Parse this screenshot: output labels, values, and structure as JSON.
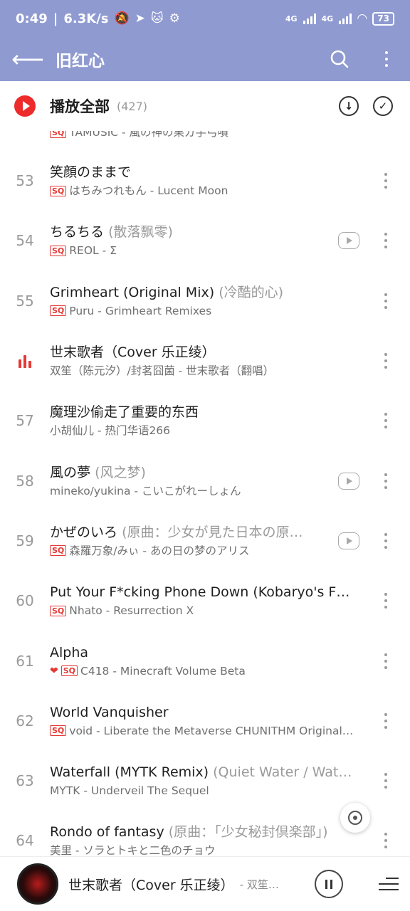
{
  "status": {
    "time": "0:49",
    "speed": "6.3K/s",
    "net1": "4G",
    "net2": "4G",
    "battery": "73"
  },
  "appbar": {
    "title": "旧红心",
    "back_icon": "arrow-left-icon",
    "search_icon": "search-icon",
    "more_icon": "more-vertical-icon"
  },
  "play_all": {
    "label": "播放全部",
    "count": "(427)"
  },
  "partial_row": {
    "subtitle": "TAMUSIC - 風の神の果ガ手弓噴"
  },
  "songs": [
    {
      "num": "53",
      "title": "笑顔のままで",
      "alias": "",
      "sq": true,
      "heart": false,
      "mv": false,
      "sub": "はちみつれもん - Lucent Moon"
    },
    {
      "num": "54",
      "title": "ちるちる",
      "alias": "(散落飘零)",
      "sq": true,
      "heart": false,
      "mv": true,
      "sub": "REOL - Σ"
    },
    {
      "num": "55",
      "title": "Grimheart (Original Mix)",
      "alias": "(冷酷的心)",
      "sq": true,
      "heart": false,
      "mv": false,
      "sub": "Puru - Grimheart Remixes"
    },
    {
      "num": "",
      "title": "世末歌者（Cover 乐正绫）",
      "alias": "",
      "sq": false,
      "heart": false,
      "mv": false,
      "playing": true,
      "sub": "双笙（陈元汐）/封茗囧菌 - 世末歌者（翻唱）"
    },
    {
      "num": "57",
      "title": "魔理沙偷走了重要的东西",
      "alias": "",
      "sq": false,
      "heart": false,
      "mv": false,
      "sub": "小胡仙儿 - 热门华语266"
    },
    {
      "num": "58",
      "title": "風の夢",
      "alias": "(风之梦)",
      "sq": false,
      "heart": false,
      "mv": true,
      "sub": "mineko/yukina - こいこがれーしょん"
    },
    {
      "num": "59",
      "title": "かぜのいろ",
      "alias": "(原曲：少女が見た日本の原…",
      "sq": true,
      "heart": false,
      "mv": true,
      "sub": "森羅万象/みぃ - あの日の梦のアリス"
    },
    {
      "num": "60",
      "title": "Put Your F*cking Phone Down (Kobaryo's F…",
      "alias": "",
      "sq": true,
      "heart": false,
      "mv": false,
      "sub": "Nhato - Resurrection X"
    },
    {
      "num": "61",
      "title": "Alpha",
      "alias": "",
      "sq": true,
      "heart": true,
      "mv": false,
      "sub": "C418 - Minecraft   Volume Beta"
    },
    {
      "num": "62",
      "title": "World Vanquisher",
      "alias": "",
      "sq": true,
      "heart": false,
      "mv": false,
      "sub": "void - Liberate the Metaverse CHUNITHM Original…"
    },
    {
      "num": "63",
      "title": "Waterfall (MYTK Remix)",
      "alias": "(Quiet Water / Wat…",
      "sq": false,
      "heart": false,
      "mv": false,
      "sub": "MYTK - Underveil The Sequel"
    },
    {
      "num": "64",
      "title": "Rondo of fantasy",
      "alias": "(原曲：「少女秘封倶楽部」)",
      "sq": false,
      "heart": false,
      "mv": false,
      "sub": "美里 - ソラとトキと二色のチョウ"
    }
  ],
  "mini_player": {
    "title": "世末歌者（Cover 乐正绫）",
    "artist": "- 双笙…"
  }
}
